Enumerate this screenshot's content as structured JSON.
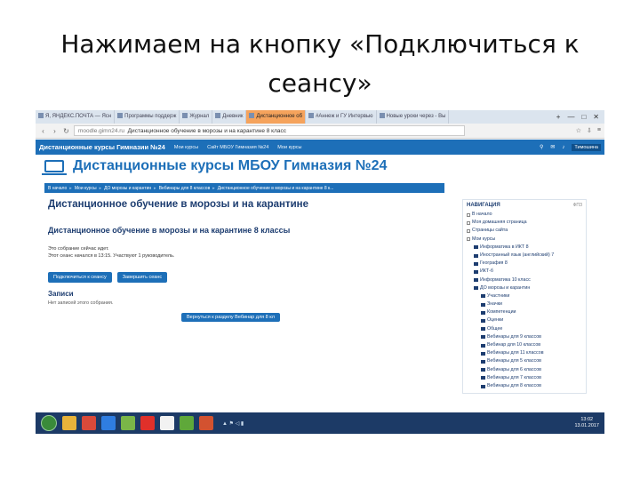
{
  "slide": {
    "title": "Нажимаем на кнопку «Подключиться к сеансу»"
  },
  "browser": {
    "tabs": [
      {
        "label": "Я, ЯНДЕКС.ПОЧТА — Ясн"
      },
      {
        "label": "Программы поддерж"
      },
      {
        "label": "Журнал"
      },
      {
        "label": "Дневник"
      },
      {
        "label": "Дистанционное об",
        "active": true
      },
      {
        "label": "#Аннеж и ГУ Интервью"
      },
      {
        "label": "Новые уроки через - Вы"
      }
    ],
    "tab_actions": [
      "+",
      "—",
      "□",
      "✕"
    ],
    "url_domain": "moodle.gimn24.ru",
    "url_title": "Дистанционное обучение в морозы и на карантине 8 класс"
  },
  "site": {
    "brand": "Дистанционные курсы Гимназии №24",
    "nav_links": [
      "Мои курсы",
      "Сайт МБОУ Гимназия №24",
      "Мои курсы"
    ],
    "user": "Тимошина",
    "header": "Дистанционные курсы МБОУ Гимназия №24",
    "crumbs": [
      "В начало",
      "Мои курсы",
      "ДО морозы и карантин",
      "Вебинары для 8 классов",
      "Дистанционное обучение в морозы и на карантине 8 к..."
    ]
  },
  "main": {
    "h1": "Дистанционное обучение в морозы и на карантине",
    "h2": "Дистанционное обучение в морозы и на карантине 8 классы",
    "meta1": "Это собрание сейчас идет.",
    "meta2": "Этот сеанс начался в 13:15. Участвуют 1 руководитель.",
    "btn_connect": "Подключиться к сеансу",
    "btn_close": "Завершить сеанс",
    "records_title": "Записи",
    "records_note": "Нет записей этого собрания.",
    "back_button": "Вернуться к разделу Вебинар для 8 кл"
  },
  "sidebar": {
    "title": "НАВИГАЦИЯ",
    "mini": "ФПЗ",
    "items": [
      {
        "label": "В начало",
        "kind": "box"
      },
      {
        "label": "Моя домашняя страница",
        "kind": "box"
      },
      {
        "label": "Страницы сайта",
        "kind": "box"
      },
      {
        "label": "Мои курсы",
        "kind": "box"
      },
      {
        "label": "Информатика в ИКТ 8",
        "kind": "folder"
      },
      {
        "label": "Иностранный язык (английский) 7",
        "kind": "folder"
      },
      {
        "label": "География 8",
        "kind": "folder"
      },
      {
        "label": "ИКТ-б",
        "kind": "folder"
      },
      {
        "label": "Информатика 10 класс",
        "kind": "folder"
      },
      {
        "label": "ДО морозы и карантин",
        "kind": "folder"
      },
      {
        "label": "Участники",
        "kind": "folder"
      },
      {
        "label": "Значки",
        "kind": "folder"
      },
      {
        "label": "Компетенции",
        "kind": "folder"
      },
      {
        "label": "Оценки",
        "kind": "folder"
      },
      {
        "label": "Общее",
        "kind": "folder"
      },
      {
        "label": "Вебинары для 9 классов",
        "kind": "folder"
      },
      {
        "label": "Вебинар для 10 классов",
        "kind": "folder"
      },
      {
        "label": "Вебинары для 11 классов",
        "kind": "folder"
      },
      {
        "label": "Вебинары для 5 классов",
        "kind": "folder"
      },
      {
        "label": "Вебинары для 6 классов",
        "kind": "folder"
      },
      {
        "label": "Вебинары для 7 классов",
        "kind": "folder"
      },
      {
        "label": "Вебинары для 8 классов",
        "kind": "folder"
      }
    ]
  },
  "taskbar": {
    "time": "13:02",
    "date": "13.01.2017",
    "apps": [
      {
        "name": "explorer",
        "color": "#e8b33a"
      },
      {
        "name": "chrome",
        "color": "#d94a3a"
      },
      {
        "name": "browser",
        "color": "#2f7de1"
      },
      {
        "name": "photos",
        "color": "#7ab648"
      },
      {
        "name": "yandex",
        "color": "#e0302a"
      },
      {
        "name": "yandex-browser",
        "color": "#f2f2f2"
      },
      {
        "name": "app",
        "color": "#5fa83a"
      },
      {
        "name": "powerpoint",
        "color": "#d35230"
      }
    ]
  },
  "colors": {
    "accent": "#1d6fb8",
    "active_tab": "#f5a35c",
    "taskbar": "#1c3a66"
  }
}
